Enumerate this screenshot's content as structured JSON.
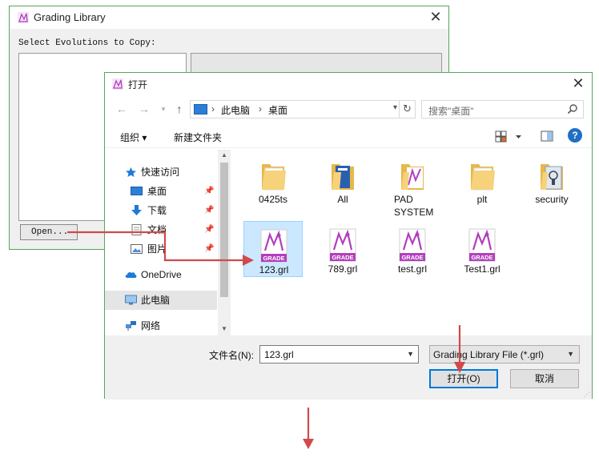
{
  "grading_library": {
    "title": "Grading Library",
    "close_glyph": "✕",
    "select_label": "Select Evolutions to Copy:",
    "open_button": "Open..."
  },
  "open_dialog": {
    "title": "打开",
    "close_glyph": "✕",
    "breadcrumb": [
      "此电脑",
      "桌面"
    ],
    "breadcrumb_sep": "›",
    "search_placeholder": "搜索\"桌面\"",
    "toolbar": {
      "organize": "组织 ▾",
      "new_folder": "新建文件夹",
      "help": "?"
    },
    "nav_items": [
      {
        "label": "快速访问",
        "icon": "star-icon",
        "pinned": false
      },
      {
        "label": "桌面",
        "icon": "desktop-icon",
        "pinned": true
      },
      {
        "label": "下载",
        "icon": "download-icon",
        "pinned": true
      },
      {
        "label": "文档",
        "icon": "document-icon",
        "pinned": true
      },
      {
        "label": "图片",
        "icon": "picture-icon",
        "pinned": true
      },
      {
        "label": "OneDrive",
        "icon": "cloud-icon",
        "pinned": false
      },
      {
        "label": "此电脑",
        "icon": "computer-icon",
        "pinned": false,
        "selected": true
      },
      {
        "label": "网络",
        "icon": "network-icon",
        "pinned": false
      }
    ],
    "files": [
      {
        "name": "0425ts",
        "kind": "folder"
      },
      {
        "name": "All",
        "kind": "folder-doc"
      },
      {
        "name": "PAD SYSTEM",
        "kind": "folder-grade"
      },
      {
        "name": "plt",
        "kind": "folder"
      },
      {
        "name": "security",
        "kind": "folder-security"
      },
      {
        "name": "123.grl",
        "kind": "grl",
        "selected": true
      },
      {
        "name": "789.grl",
        "kind": "grl"
      },
      {
        "name": "test.grl",
        "kind": "grl"
      },
      {
        "name": "Test1.grl",
        "kind": "grl"
      }
    ],
    "grl_badge": "GRADE",
    "filename_label": "文件名(N):",
    "filename_value": "123.grl",
    "filetype_value": "Grading Library File (*.grl)",
    "open_button": "打开(O)",
    "cancel_button": "取消"
  },
  "colors": {
    "window_border": "#5aa55a",
    "arrow": "#d04a4a",
    "selection_fill": "#cce8ff",
    "accent_blue": "#0078d7",
    "grade_purple": "#b23fbd"
  }
}
